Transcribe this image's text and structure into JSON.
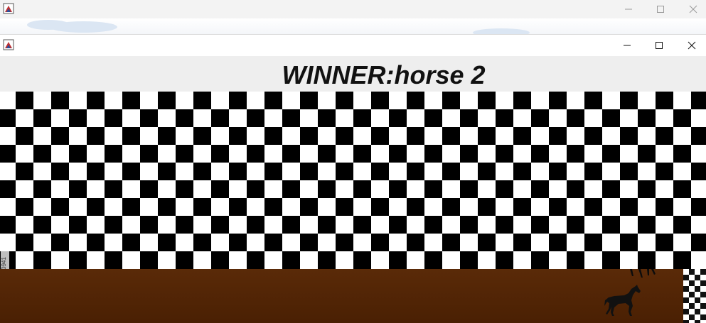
{
  "back_window": {
    "icon": "java-app-icon",
    "controls": [
      "minimize-icon",
      "maximize-icon",
      "close-icon"
    ]
  },
  "front_window": {
    "icon": "java-app-icon",
    "controls": [
      "minimize-icon",
      "maximize-icon",
      "close-icon"
    ],
    "winner_label": "WINNER:horse 2",
    "banner_watermark": "Adobe Stock | #51640941"
  },
  "race": {
    "track_color": "#4f2405",
    "horses": [
      "horse-icon",
      "horse-icon"
    ]
  }
}
